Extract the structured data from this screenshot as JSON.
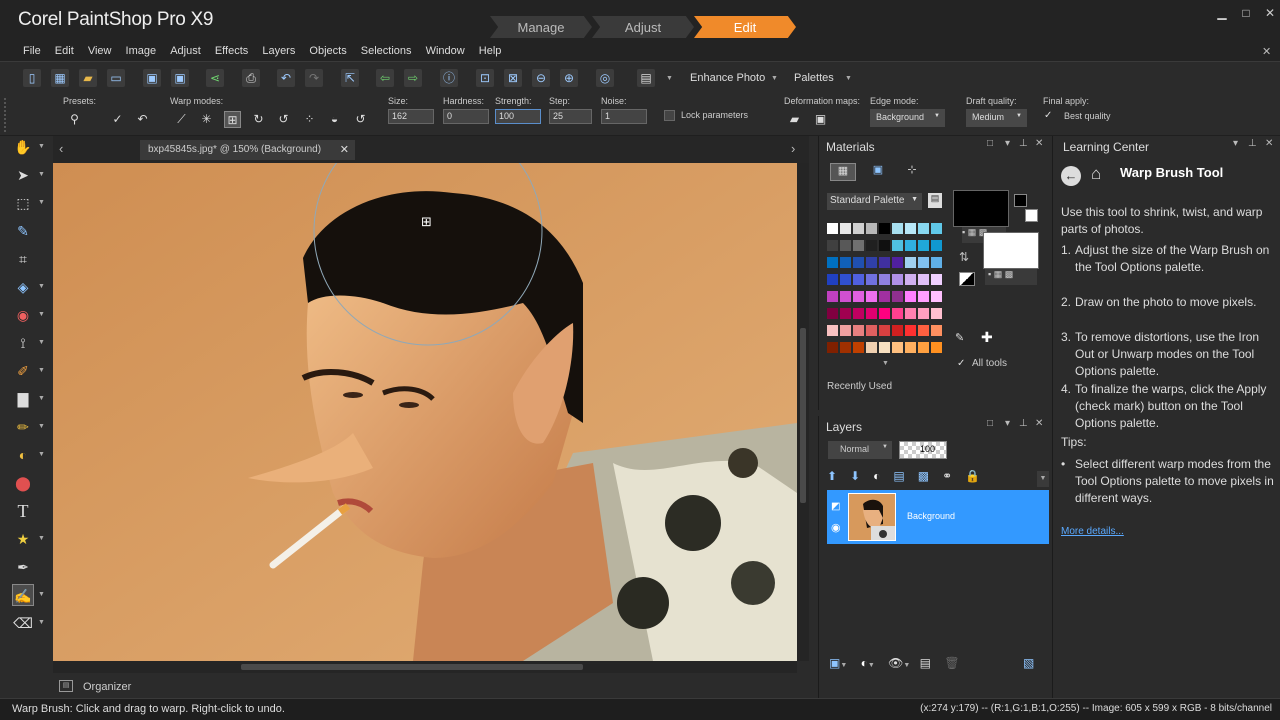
{
  "app": {
    "title": "Corel PaintShop Pro X9",
    "workspace_tabs": [
      "Manage",
      "Adjust",
      "Edit"
    ],
    "active_tab": "Edit",
    "accent": "#f08a2a"
  },
  "menu": [
    "File",
    "Edit",
    "View",
    "Image",
    "Adjust",
    "Effects",
    "Layers",
    "Objects",
    "Selections",
    "Window",
    "Help"
  ],
  "toolbar": {
    "enhance_label": "Enhance Photo",
    "palettes_label": "Palettes"
  },
  "tool_options": {
    "presets_label": "Presets:",
    "warp_modes_label": "Warp modes:",
    "size_label": "Size:",
    "size_value": "162",
    "hardness_label": "Hardness:",
    "hardness_value": "0",
    "strength_label": "Strength:",
    "strength_value": "100",
    "step_label": "Step:",
    "step_value": "25",
    "noise_label": "Noise:",
    "noise_value": "1",
    "lock_params_label": "Lock parameters",
    "deformation_label": "Deformation maps:",
    "edge_mode_label": "Edge mode:",
    "edge_mode_value": "Background",
    "draft_quality_label": "Draft quality:",
    "draft_quality_value": "Medium",
    "final_apply_label": "Final apply:",
    "final_apply_value": "Best quality"
  },
  "document": {
    "tab_title": "bxp45845s.jpg* @ 150% (Background)"
  },
  "materials": {
    "title": "Materials",
    "palette_select": "Standard Palette",
    "recently_used_label": "Recently Used",
    "all_tools_label": "All tools",
    "swatch_rows": [
      [
        "#ffffff",
        "#e8e8e8",
        "#d0d0d0",
        "#b8b8b8",
        "#000000",
        "#a8e0f0",
        "#b8e8f8",
        "#88d8f0",
        "#60c8e8"
      ],
      [
        "#404040",
        "#585858",
        "#707070",
        "#202020",
        "#101010",
        "#50c0e0",
        "#30b0e0",
        "#20a8d8",
        "#1098d0"
      ],
      [
        "#0070c0",
        "#1060b8",
        "#2050b0",
        "#3040a8",
        "#4030a0",
        "#5020a0",
        "#a0d0f0",
        "#80c0f0",
        "#60b0e8"
      ],
      [
        "#2040c0",
        "#3050d0",
        "#5060e0",
        "#7070e0",
        "#9080e0",
        "#b090e8",
        "#d0b0f0",
        "#e0c0f8",
        "#f0d0ff"
      ],
      [
        "#c040c0",
        "#d050d0",
        "#e060e0",
        "#f070f0",
        "#a030a0",
        "#903090",
        "#ff80ff",
        "#ffa0ff",
        "#ffc0ff"
      ],
      [
        "#800040",
        "#a00050",
        "#c00060",
        "#e00070",
        "#ff0080",
        "#ff4090",
        "#ff80b0",
        "#ffa0c0",
        "#ffc0d0"
      ],
      [
        "#f8c0c0",
        "#f0a0a0",
        "#e88080",
        "#e06060",
        "#d84040",
        "#d02020",
        "#ff3030",
        "#ff6040",
        "#ff9060"
      ],
      [
        "#802000",
        "#a03000",
        "#c04000",
        "#f0d0b0",
        "#f8e0c0",
        "#ffc080",
        "#ffb060",
        "#ffa040",
        "#ff9020"
      ]
    ]
  },
  "layers": {
    "title": "Layers",
    "blend_mode": "Normal",
    "opacity": "100",
    "layer_name": "Background"
  },
  "learning_center": {
    "title": "Learning Center",
    "heading": "Warp Brush Tool",
    "intro": "Use this tool to shrink, twist, and warp parts of photos.",
    "steps": [
      {
        "n": "1.",
        "t": "Adjust the size of the Warp Brush on the Tool Options palette."
      },
      {
        "n": "2.",
        "t": "Draw on the photo to move pixels."
      },
      {
        "n": "3.",
        "t": "To remove distortions, use the Iron Out or Unwarp modes on the Tool Options palette."
      },
      {
        "n": "4.",
        "t": "To finalize the warps, click the Apply (check mark) button on the Tool Options palette."
      }
    ],
    "tips_label": "Tips:",
    "tip": "Select different warp modes from the Tool Options palette to move pixels in different ways.",
    "more_link": "More details..."
  },
  "organizer_label": "Organizer",
  "status": {
    "left": "Warp Brush: Click and drag to warp. Right-click to undo.",
    "right": "(x:274 y:179) -- (R:1,G:1,B:1,O:255) -- Image:  605 x 599 x RGB - 8 bits/channel"
  }
}
